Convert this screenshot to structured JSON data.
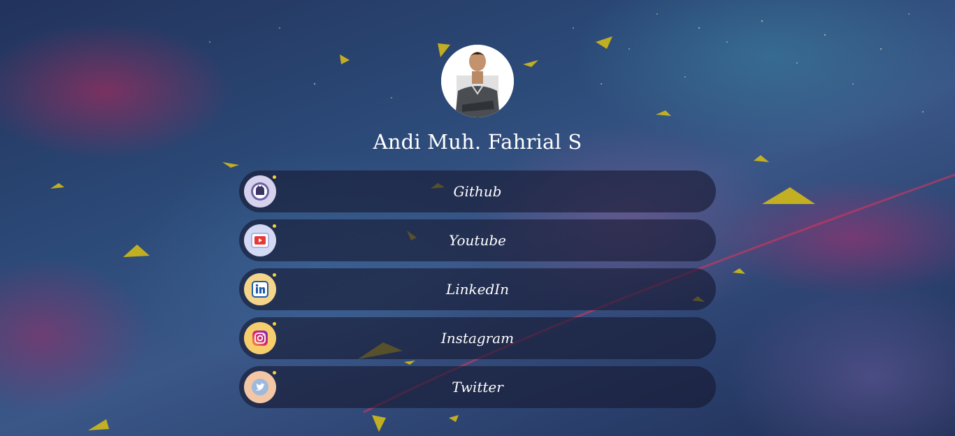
{
  "profile": {
    "name": "Andi Muh. Fahrial S"
  },
  "links": [
    {
      "label": "Github",
      "icon": "github-icon",
      "icon_bg": "#d7d2ec"
    },
    {
      "label": "Youtube",
      "icon": "youtube-icon",
      "icon_bg": "#d4d9f4"
    },
    {
      "label": "LinkedIn",
      "icon": "linkedin-icon",
      "icon_bg": "#f4d58a"
    },
    {
      "label": "Instagram",
      "icon": "instagram-icon",
      "icon_bg": "#f6cf6c"
    },
    {
      "label": "Twitter",
      "icon": "twitter-icon",
      "icon_bg": "#f3c7a6"
    }
  ],
  "colors": {
    "link_bg": "rgba(22,24,48,0.62)",
    "text": "#ffffff",
    "accent_shard": "#c7b51e"
  }
}
